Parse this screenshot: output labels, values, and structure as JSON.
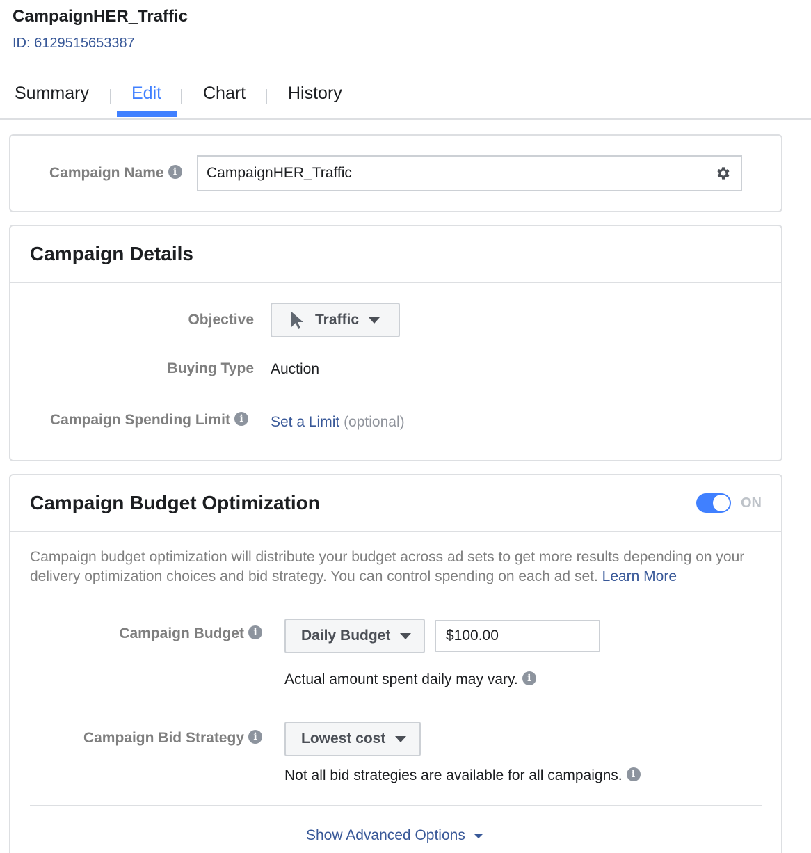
{
  "header": {
    "title": "CampaignHER_Traffic",
    "id_text": "ID: 6129515653387"
  },
  "tabs": [
    {
      "label": "Summary",
      "active": false
    },
    {
      "label": "Edit",
      "active": true
    },
    {
      "label": "Chart",
      "active": false
    },
    {
      "label": "History",
      "active": false
    }
  ],
  "campaign_name": {
    "label": "Campaign Name",
    "value": "CampaignHER_Traffic"
  },
  "campaign_details": {
    "title": "Campaign Details",
    "objective_label": "Objective",
    "objective_value": "Traffic",
    "buying_type_label": "Buying Type",
    "buying_type_value": "Auction",
    "spending_limit_label": "Campaign Spending Limit",
    "spending_limit_link": "Set a Limit",
    "spending_limit_optional": "(optional)"
  },
  "budget_optimization": {
    "title": "Campaign Budget Optimization",
    "toggle_state": "ON",
    "description": "Campaign budget optimization will distribute your budget across ad sets to get more results depending on your delivery optimization choices and bid strategy. You can control spending on each ad set.",
    "learn_more": "Learn More",
    "budget_label": "Campaign Budget",
    "budget_type": "Daily Budget",
    "budget_amount": "$100.00",
    "budget_note": "Actual amount spent daily may vary.",
    "bid_strategy_label": "Campaign Bid Strategy",
    "bid_strategy_value": "Lowest cost",
    "bid_strategy_note": "Not all bid strategies are available for all campaigns.",
    "advanced_options": "Show Advanced Options"
  },
  "colors": {
    "accent": "#4080ff",
    "link": "#385898",
    "border": "#dddfe2"
  }
}
